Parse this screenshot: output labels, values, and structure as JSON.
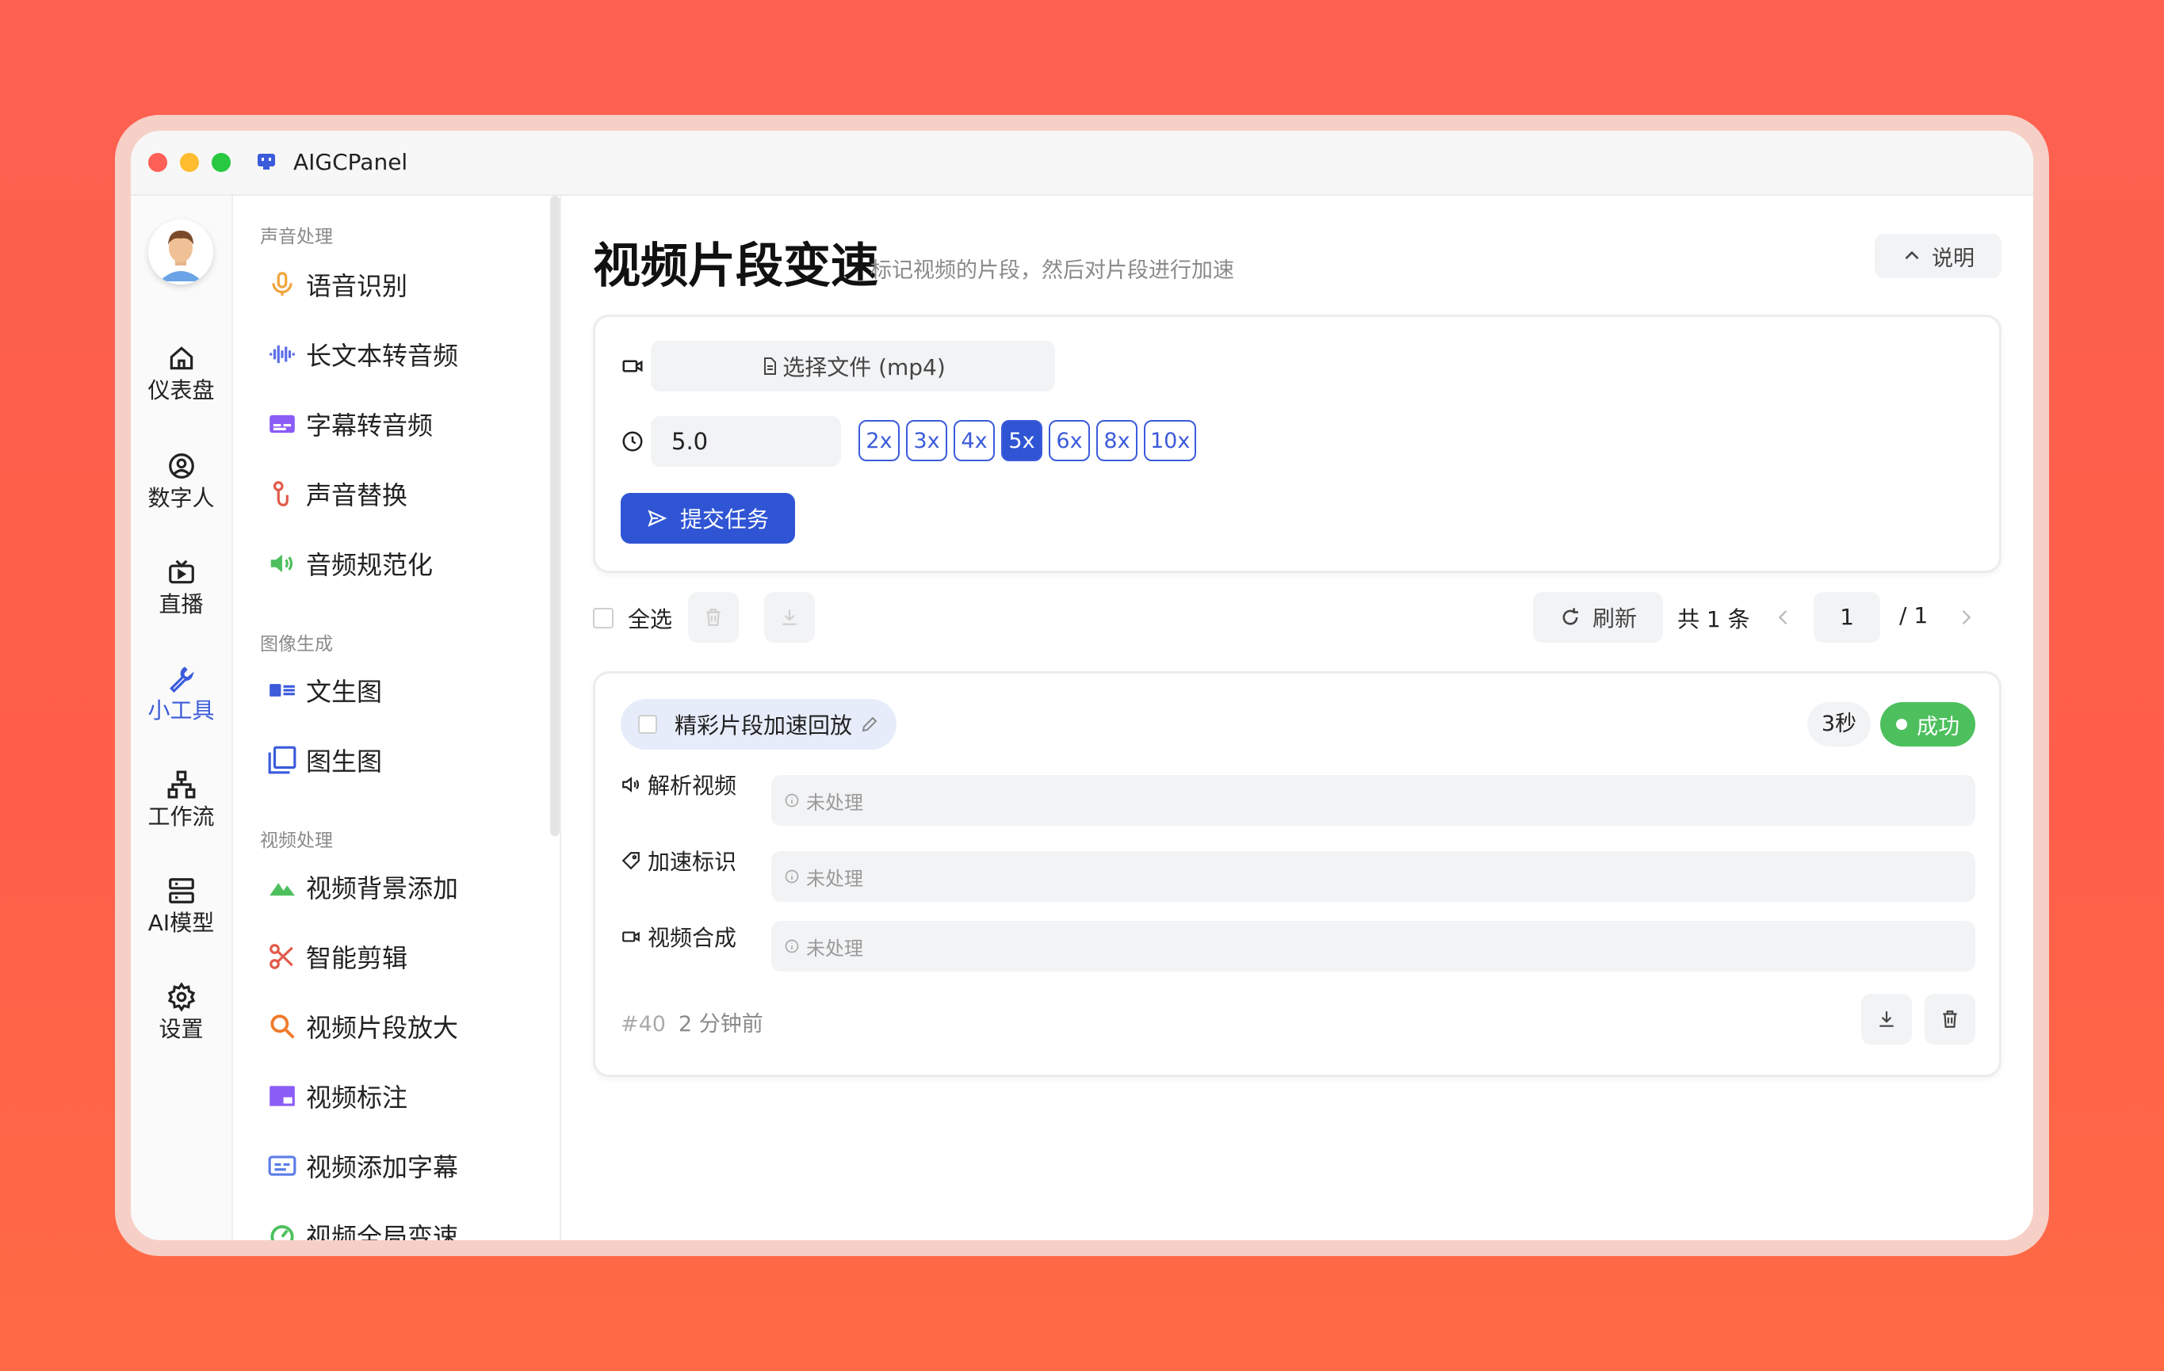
{
  "window": {
    "title": "AIGCPanel"
  },
  "rail": {
    "items": [
      {
        "label": "仪表盘",
        "icon": "home-icon"
      },
      {
        "label": "数字人",
        "icon": "user-circle-icon"
      },
      {
        "label": "直播",
        "icon": "tv-icon"
      },
      {
        "label": "小工具",
        "icon": "wrench-icon",
        "active": true
      },
      {
        "label": "工作流",
        "icon": "workflow-icon"
      },
      {
        "label": "AI模型",
        "icon": "server-icon"
      },
      {
        "label": "设置",
        "icon": "gear-icon"
      }
    ]
  },
  "menu": {
    "groups": [
      {
        "title": "声音处理",
        "items": [
          "语音识别",
          "长文本转音频",
          "字幕转音频",
          "声音替换",
          "音频规范化"
        ]
      },
      {
        "title": "图像生成",
        "items": [
          "文生图",
          "图生图"
        ]
      },
      {
        "title": "视频处理",
        "items": [
          "视频背景添加",
          "智能剪辑",
          "视频片段放大",
          "视频标注",
          "视频添加字幕",
          "视频全局变速"
        ]
      }
    ]
  },
  "page": {
    "title": "视频片段变速",
    "subtitle": "标记视频的片段，然后对片段进行加速",
    "help_label": "说明"
  },
  "form": {
    "file_button": "选择文件 (mp4)",
    "speed_value": "5.0",
    "speed_options": [
      "2x",
      "3x",
      "4x",
      "5x",
      "6x",
      "8x",
      "10x"
    ],
    "selected_speed": "5x",
    "submit_label": "提交任务"
  },
  "toolbar": {
    "select_all": "全选",
    "refresh": "刷新",
    "total": "共 1 条",
    "page": "1",
    "page_of": "/  1"
  },
  "task": {
    "name": "精彩片段加速回放",
    "duration": "3秒",
    "status": "成功",
    "steps": [
      {
        "label": "解析视频",
        "status": "未处理",
        "icon": "speaker-icon"
      },
      {
        "label": "加速标识",
        "status": "未处理",
        "icon": "tag-icon"
      },
      {
        "label": "视频合成",
        "status": "未处理",
        "icon": "video-icon"
      }
    ],
    "id": "#40",
    "time": "2 分钟前"
  },
  "colors": {
    "accent": "#2f55d4",
    "success": "#4dc05d",
    "background": "#fe6150"
  }
}
